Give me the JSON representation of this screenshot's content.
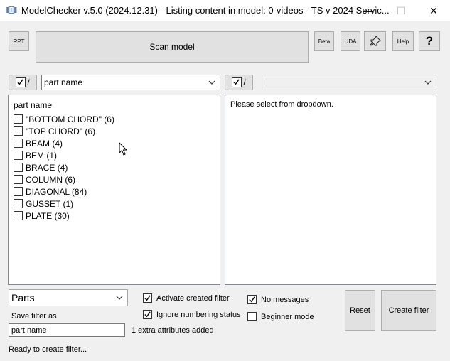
{
  "window": {
    "title": "ModelChecker v.5.0 (2024.12.31) - Listing content in model: 0-videos - TS v 2024 Servic...",
    "minimize": "—",
    "maximize": "☐",
    "close": "✕"
  },
  "toolbar": {
    "rpt": "RPT",
    "scan": "Scan model",
    "beta": "Beta",
    "uda": "UDA",
    "help": "Help",
    "question": "?"
  },
  "left_panel": {
    "check_label": "/",
    "attribute": "part name",
    "header": "part name",
    "items": [
      {
        "label": "\"BOTTOM CHORD\" (6)"
      },
      {
        "label": "\"TOP CHORD\" (6)"
      },
      {
        "label": "BEAM (4)"
      },
      {
        "label": "BEM (1)"
      },
      {
        "label": "BRACE (4)"
      },
      {
        "label": "COLUMN (6)"
      },
      {
        "label": "DIAGONAL (84)"
      },
      {
        "label": "GUSSET (1)"
      },
      {
        "label": "PLATE (30)"
      }
    ]
  },
  "right_panel": {
    "check_label": "/",
    "attribute": "",
    "message": "Please select from dropdown."
  },
  "bottom": {
    "object_type": "Parts",
    "save_filter_label": "Save filter as",
    "save_filter_value": "part name",
    "extra_attrs": "1 extra attributes added",
    "activate_filter": {
      "label": "Activate created filter",
      "checked": true
    },
    "ignore_numbering": {
      "label": "Ignore numbering status",
      "checked": true
    },
    "no_messages": {
      "label": "No messages",
      "checked": true
    },
    "beginner_mode": {
      "label": "Beginner mode",
      "checked": false
    },
    "reset": "Reset",
    "create_filter": "Create filter"
  },
  "status": "Ready to create filter..."
}
